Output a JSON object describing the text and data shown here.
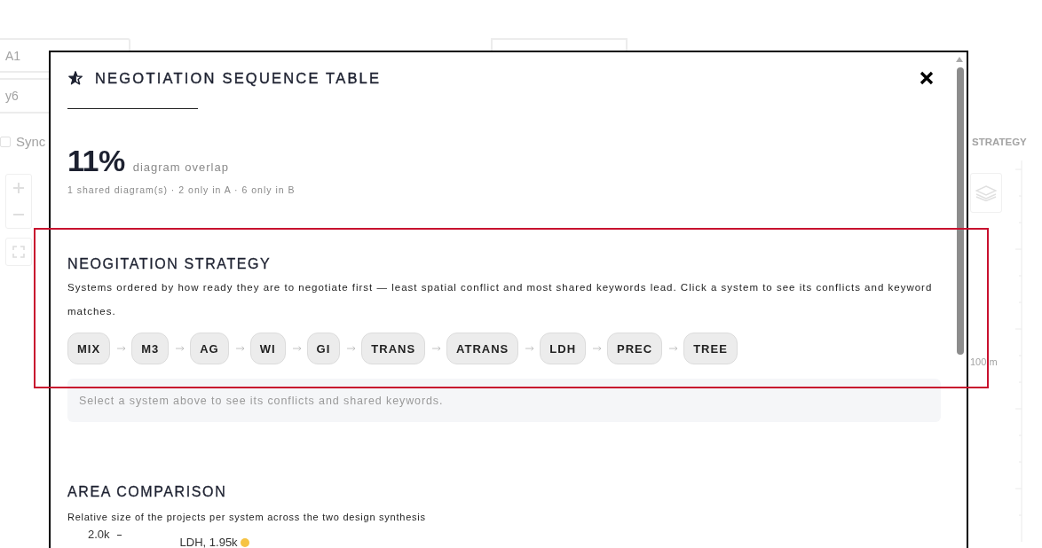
{
  "background": {
    "inputs": [
      {
        "value": "A1"
      },
      {
        "value": "y6"
      }
    ],
    "sync": {
      "label": "Sync",
      "checked": false
    },
    "side_heading": "STRATEGY",
    "scale_label": "100 m"
  },
  "modal": {
    "title": "NEGOTIATION SEQUENCE TABLE",
    "overlap": {
      "value": "11%",
      "label": "diagram overlap",
      "summary": "1 shared diagram(s) · 2 only in A · 6 only in B"
    },
    "strategy": {
      "highlighted": true,
      "heading": "NEOGITATION STRATEGY",
      "description": "Systems ordered by how ready they are to negotiate first — least spatial conflict and most shared keywords lead. Click a system to see its conflicts and keyword matches.",
      "systems": [
        {
          "label": "MIX",
          "selected": false
        },
        {
          "label": "M3",
          "selected": false
        },
        {
          "label": "AG",
          "selected": false
        },
        {
          "label": "WI",
          "selected": false
        },
        {
          "label": "GI",
          "selected": false
        },
        {
          "label": "TRANS",
          "selected": false
        },
        {
          "label": "ATRANS",
          "selected": false
        },
        {
          "label": "LDH",
          "selected": false
        },
        {
          "label": "PREC",
          "selected": false
        },
        {
          "label": "TREE",
          "selected": false
        }
      ],
      "hint": "Select a system above to see its conflicts and shared keywords."
    },
    "area": {
      "heading": "AREA COMPARISON",
      "description": "Relative size of the projects per system across the two design synthesis",
      "plot": {
        "tick_label": "2.0k",
        "points": [
          {
            "label": "LDH, 1.95k",
            "color": "#f6c344"
          }
        ]
      }
    }
  }
}
